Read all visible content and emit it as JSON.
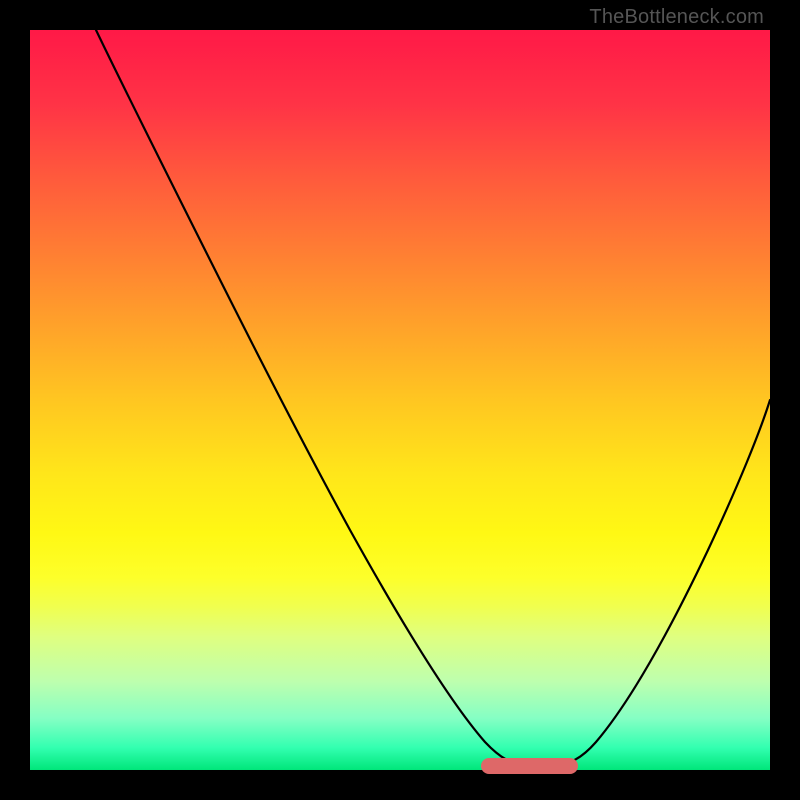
{
  "watermark": "TheBottleneck.com",
  "colors": {
    "frame": "#000000",
    "marker": "#de6868",
    "curve": "#000000",
    "text": "#555555"
  },
  "gradient_stops": [
    {
      "pct": 0,
      "hex": "#ff1947"
    },
    {
      "pct": 10,
      "hex": "#ff3346"
    },
    {
      "pct": 20,
      "hex": "#ff5a3c"
    },
    {
      "pct": 30,
      "hex": "#ff7e33"
    },
    {
      "pct": 40,
      "hex": "#ffa22a"
    },
    {
      "pct": 50,
      "hex": "#ffc621"
    },
    {
      "pct": 60,
      "hex": "#ffe61a"
    },
    {
      "pct": 68,
      "hex": "#fff814"
    },
    {
      "pct": 74,
      "hex": "#fdff2a"
    },
    {
      "pct": 78,
      "hex": "#f0ff50"
    },
    {
      "pct": 82,
      "hex": "#dfff80"
    },
    {
      "pct": 88,
      "hex": "#beffae"
    },
    {
      "pct": 93,
      "hex": "#85ffc4"
    },
    {
      "pct": 97,
      "hex": "#32ffb0"
    },
    {
      "pct": 100,
      "hex": "#00e67a"
    }
  ],
  "chart_data": {
    "type": "line",
    "title": "",
    "xlabel": "",
    "ylabel": "",
    "xlim": [
      0,
      100
    ],
    "ylim": [
      0,
      100
    ],
    "grid": false,
    "note": "Two V-shaped bottleneck curves on a red-to-green vertical heat gradient. Y represents bottleneck (100 top = worst, 0 bottom = best). X is normalized 0–100. Values estimated from pixel positions.",
    "series": [
      {
        "name": "left-curve",
        "x": [
          9,
          15,
          20,
          25,
          30,
          35,
          40,
          45,
          50,
          55,
          60,
          62,
          66,
          70
        ],
        "y": [
          100,
          90,
          81,
          72,
          63,
          54,
          45,
          36,
          27,
          18,
          8,
          4,
          1,
          1
        ]
      },
      {
        "name": "right-curve",
        "x": [
          70,
          74,
          78,
          82,
          86,
          90,
          94,
          98,
          100
        ],
        "y": [
          1,
          3,
          8,
          15,
          23,
          32,
          41,
          50,
          55
        ]
      }
    ],
    "marker": {
      "description": "optimal / flat-bottom region highlighted in salmon",
      "x_range": [
        61,
        74
      ],
      "y": 0.5
    }
  }
}
